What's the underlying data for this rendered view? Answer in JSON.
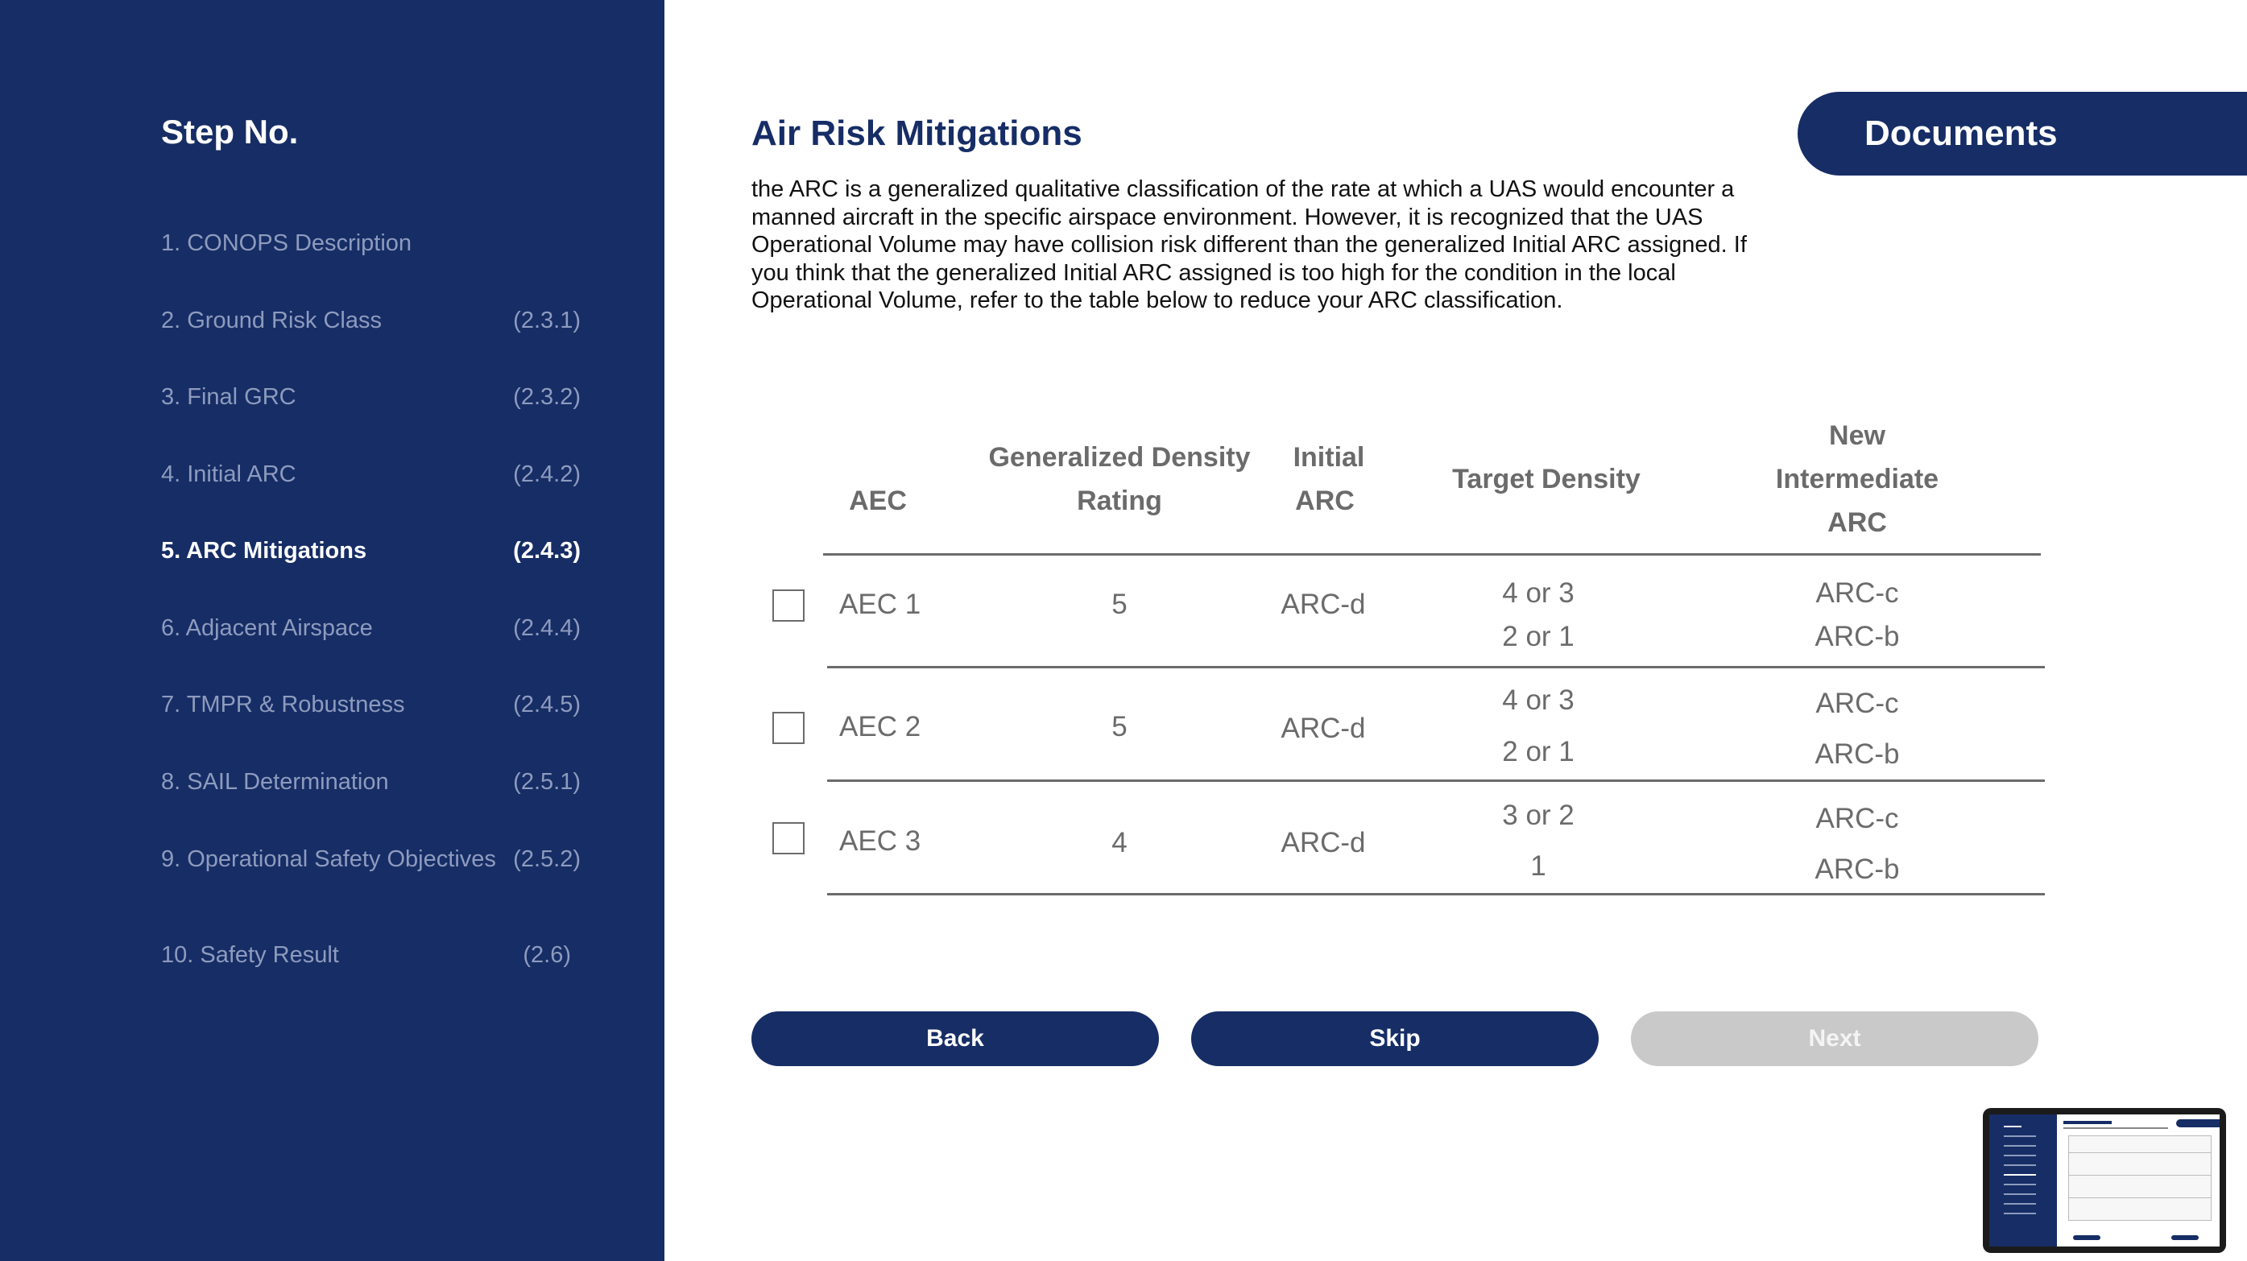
{
  "sidebar": {
    "title": "Step No.",
    "steps": [
      {
        "label": "1. CONOPS Description",
        "code": ""
      },
      {
        "label": "2. Ground Risk Class",
        "code": "(2.3.1)"
      },
      {
        "label": "3. Final GRC",
        "code": "(2.3.2)"
      },
      {
        "label": "4. Initial ARC",
        "code": "(2.4.2)"
      },
      {
        "label": "5. ARC Mitigations",
        "code": "(2.4.3)",
        "active": true
      },
      {
        "label": "6. Adjacent Airspace",
        "code": "(2.4.4)"
      },
      {
        "label": "7. TMPR & Robustness",
        "code": "(2.4.5)"
      },
      {
        "label": "8. SAIL Determination",
        "code": "(2.5.1)"
      },
      {
        "label": "9. Operational Safety Objectives",
        "code": "(2.5.2)"
      },
      {
        "label": "10. Safety Result",
        "code": "(2.6)"
      }
    ]
  },
  "main": {
    "title": "Air Risk Mitigations",
    "description": "the ARC is a generalized qualitative classification of the rate at which a UAS would encounter a manned aircraft in the specific airspace environment. However, it is recognized that the UAS Operational Volume may have collision risk different than the generalized Initial ARC assigned. If you think that the generalized Initial ARC assigned is too high for the condition in the local Operational Volume, refer to the table below to reduce your ARC classification.",
    "documents_label": "Documents"
  },
  "table": {
    "headers": {
      "aec": "AEC",
      "density_l1": "Generalized Density",
      "density_l2": "Rating",
      "initial_l1": "Initial",
      "initial_l2": "ARC",
      "target": "Target Density",
      "new_l1": "New",
      "new_l2": "Intermediate",
      "new_l3": "ARC"
    },
    "rows": [
      {
        "aec": "AEC 1",
        "density": "5",
        "initial": "ARC-d",
        "target": [
          "4 or 3",
          "2 or 1"
        ],
        "new": [
          "ARC-c",
          "ARC-b"
        ],
        "checked": false
      },
      {
        "aec": "AEC 2",
        "density": "5",
        "initial": "ARC-d",
        "target": [
          "4 or 3",
          "2 or 1"
        ],
        "new": [
          "ARC-c",
          "ARC-b"
        ],
        "checked": false
      },
      {
        "aec": "AEC 3",
        "density": "4",
        "initial": "ARC-d",
        "target": [
          "3 or 2",
          "1"
        ],
        "new": [
          "ARC-c",
          "ARC-b"
        ],
        "checked": false
      }
    ]
  },
  "buttons": {
    "back": "Back",
    "skip": "Skip",
    "next": "Next"
  },
  "colors": {
    "brand_navy": "#162d66",
    "muted_text": "#8e9bbd",
    "table_text": "#6b6b6b",
    "disabled_button": "#c9c9c9"
  },
  "icons": {
    "checkbox": "checkbox-icon",
    "close": "close-icon"
  },
  "preview": {
    "close_glyph": "×"
  }
}
